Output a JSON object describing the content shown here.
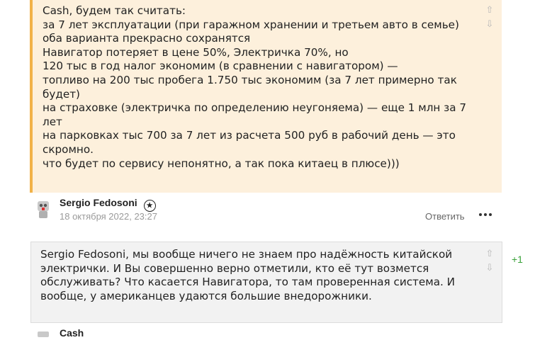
{
  "comment1": {
    "lines": [
      "Cash, будем так считать:",
      "за 7 лет эксплуатации (при гаражном хранении и третьем авто в семье) оба варианта прекрасно сохранятся",
      "Навигатор потеряет в цене 50%, Электричка 70%, но",
      "120 тыс в год налог экономим (в сравнении с навигатором) —",
      "топливо на 200 тыс пробега 1.750 тыс экономим  (за 7 лет примерно так будет)",
      "на страховке (электричка по определению неугоняема) — еще 1 млн за 7 лет",
      "на парковках тыс 700 за 7 лет  из расчета 500 руб в рабочий день — это скромно.",
      "что будет по сервису непонятно, а так пока китаец в плюсе)))"
    ],
    "vote_up": "⇧",
    "vote_down": "⇩"
  },
  "author": {
    "name": "Sergio Fedosoni",
    "badge_icon": "star-badge-icon",
    "timestamp": "18 октября 2022, 23:27",
    "reply_label": "Ответить",
    "more_icon": "more-dots-icon"
  },
  "comment2": {
    "text": "Sergio Fedosoni, мы вообще ничего не знаем про надёжность китайской электрички. И Вы совершенно верно отметили, кто её тут возмется обслуживать? Что касается Навигатора, то там проверенная система. И вообще, у американцев удаются большие внедорожники.",
    "vote_up": "⇧",
    "vote_down": "⇩",
    "rating": "+1"
  },
  "next_author": {
    "name": "Cash"
  },
  "colors": {
    "highlight_bg": "#fdf0dc",
    "highlight_border": "#f2b248",
    "normal_bg": "#f2f2f2",
    "rating": "#3aa23a"
  }
}
